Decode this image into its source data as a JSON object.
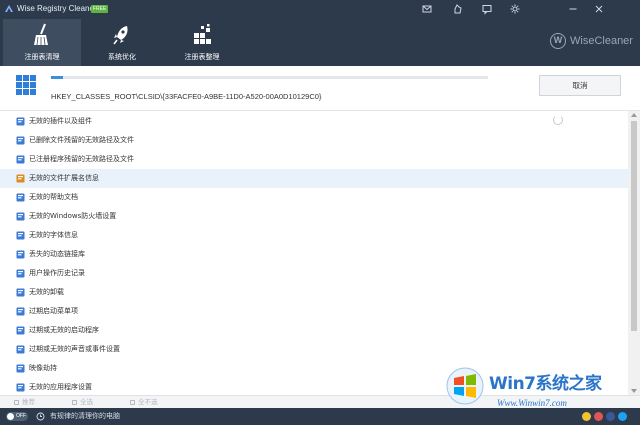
{
  "app": {
    "title": "Wise Registry Cleaner X",
    "badge": "FREE",
    "brand": "WiseCleaner",
    "brand_mark": "W"
  },
  "titlebar_icons": [
    "mail-icon",
    "thumbs-up-icon",
    "comment-icon",
    "settings-icon",
    "minimize-icon",
    "close-icon"
  ],
  "tabs": [
    {
      "label": "注册表清理",
      "icon": "broom-icon",
      "active": true
    },
    {
      "label": "系统优化",
      "icon": "rocket-icon",
      "active": false
    },
    {
      "label": "注册表整理",
      "icon": "blocks-icon",
      "active": false
    }
  ],
  "scan": {
    "progress": 0.027,
    "current_key": "HKEY_CLASSES_ROOT\\CLSID\\{33FACFE0-A9BE-11D0-A520-00A0D10129C0}",
    "cancel_label": "取消"
  },
  "items": [
    {
      "label": "无效的插件以及组件",
      "icon": "plugin-icon",
      "color": "#3a7bd5",
      "scanning": true,
      "highlighted": false
    },
    {
      "label": "已删除文件残留的无效路径及文件",
      "icon": "file-icon",
      "color": "#3a7bd5",
      "scanning": false,
      "highlighted": false
    },
    {
      "label": "已注册程序残留的无效路径及文件",
      "icon": "window-icon",
      "color": "#3a7bd5",
      "scanning": false,
      "highlighted": false
    },
    {
      "label": "无效的文件扩展名信息",
      "icon": "file-ext-icon",
      "color": "#e08a1e",
      "scanning": false,
      "highlighted": true
    },
    {
      "label": "无效的帮助文档",
      "icon": "help-doc-icon",
      "color": "#3a7bd5",
      "scanning": false,
      "highlighted": false
    },
    {
      "label": "无效的Windows防火墙设置",
      "icon": "firewall-icon",
      "color": "#3a7bd5",
      "scanning": false,
      "highlighted": false
    },
    {
      "label": "无效的字体信息",
      "icon": "font-icon",
      "color": "#3a7bd5",
      "scanning": false,
      "highlighted": false
    },
    {
      "label": "丢失的动态链接库",
      "icon": "dll-icon",
      "color": "#3a7bd5",
      "scanning": false,
      "highlighted": false
    },
    {
      "label": "用户操作历史记录",
      "icon": "history-icon",
      "color": "#3a7bd5",
      "scanning": false,
      "highlighted": false
    },
    {
      "label": "无效的卸载",
      "icon": "uninstall-icon",
      "color": "#3a7bd5",
      "scanning": false,
      "highlighted": false
    },
    {
      "label": "过期启动菜单项",
      "icon": "start-menu-icon",
      "color": "#3a7bd5",
      "scanning": false,
      "highlighted": false
    },
    {
      "label": "过期或无效的启动程序",
      "icon": "startup-icon",
      "color": "#3a7bd5",
      "scanning": false,
      "highlighted": false
    },
    {
      "label": "过期或无效的声音或事件设置",
      "icon": "sound-icon",
      "color": "#3a7bd5",
      "scanning": false,
      "highlighted": false
    },
    {
      "label": "映像劫持",
      "icon": "gear-icon",
      "color": "#3a7bd5",
      "scanning": false,
      "highlighted": false
    },
    {
      "label": "无效的应用程序设置",
      "icon": "app-settings-icon",
      "color": "#3a7bd5",
      "scanning": false,
      "highlighted": false
    }
  ],
  "actions": [
    {
      "label": "推荐",
      "icon": "recommend-icon"
    },
    {
      "label": "全选",
      "icon": "select-all-icon"
    },
    {
      "label": "全不选",
      "icon": "select-none-icon"
    }
  ],
  "status": {
    "toggle_text": "OFF",
    "message": "有规律的清理你的电脑",
    "icons": [
      "user-icon",
      "heart-icon",
      "facebook-icon",
      "twitter-icon"
    ]
  },
  "watermark": {
    "main": "Win7系统之家",
    "sub": "Www.Winwin7.com"
  },
  "colors": {
    "header_bg": "#2d3a4c",
    "active_tab_bg": "#3f4d61",
    "accent": "#3c8fdc",
    "highlight_row": "#e9f1fb"
  }
}
